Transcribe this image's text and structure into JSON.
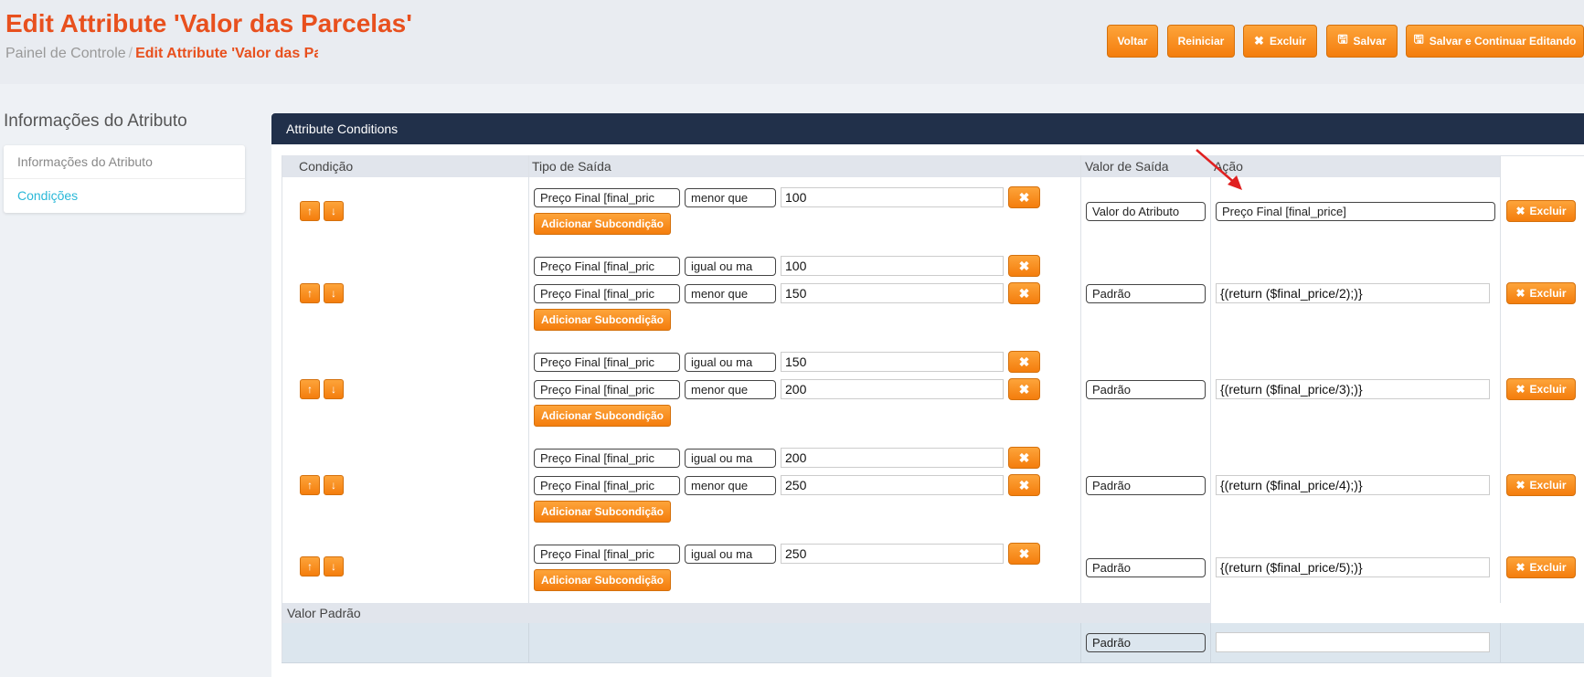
{
  "header": {
    "title": "Edit Attribute 'Valor das Parcelas'",
    "breadcrumb_home": "Painel de Controle",
    "breadcrumb_sep": "/",
    "breadcrumb_current": "Edit Attribute 'Valor das Parcelas'",
    "buttons": {
      "voltar": "Voltar",
      "reiniciar": "Reiniciar",
      "excluir": "Excluir",
      "salvar": "Salvar",
      "salvar_continuar": "Salvar e Continuar Editando"
    }
  },
  "sidebar": {
    "title": "Informações do Atributo",
    "items": [
      {
        "label": "Informações do Atributo"
      },
      {
        "label": "Condições"
      }
    ]
  },
  "panel": {
    "title": "Attribute Conditions",
    "columns": {
      "condicao": "Condição",
      "tipo_saida": "Tipo de Saída",
      "valor_saida": "Valor de Saída",
      "acao": "Ação"
    },
    "add_sub_label": "Adicionar Subcondição",
    "delete_label": "Excluir",
    "rows": [
      {
        "conditions": [
          {
            "field": "Preço Final [final_pric",
            "op": "menor que",
            "value": "100"
          }
        ],
        "output_type": "Valor do Atributo",
        "action": "Preço Final [final_price]"
      },
      {
        "conditions": [
          {
            "field": "Preço Final [final_pric",
            "op": "igual ou ma",
            "value": "100"
          },
          {
            "field": "Preço Final [final_pric",
            "op": "menor que",
            "value": "150"
          }
        ],
        "output_type": "Padrão",
        "action": "{(return ($final_price/2);)}"
      },
      {
        "conditions": [
          {
            "field": "Preço Final [final_pric",
            "op": "igual ou ma",
            "value": "150"
          },
          {
            "field": "Preço Final [final_pric",
            "op": "menor que",
            "value": "200"
          }
        ],
        "output_type": "Padrão",
        "action": "{(return ($final_price/3);)}"
      },
      {
        "conditions": [
          {
            "field": "Preço Final [final_pric",
            "op": "igual ou ma",
            "value": "200"
          },
          {
            "field": "Preço Final [final_pric",
            "op": "menor que",
            "value": "250"
          }
        ],
        "output_type": "Padrão",
        "action": "{(return ($final_price/4);)}"
      },
      {
        "conditions": [
          {
            "field": "Preço Final [final_pric",
            "op": "igual ou ma",
            "value": "250"
          }
        ],
        "output_type": "Padrão",
        "action": "{(return ($final_price/5);)}"
      }
    ],
    "default_label": "Valor Padrão",
    "default_output_type": "Padrão",
    "default_action": ""
  },
  "colors": {
    "accent": "#e8501e",
    "button": "#f7901e",
    "panel_header": "#21304a",
    "link": "#2ab8d8"
  }
}
